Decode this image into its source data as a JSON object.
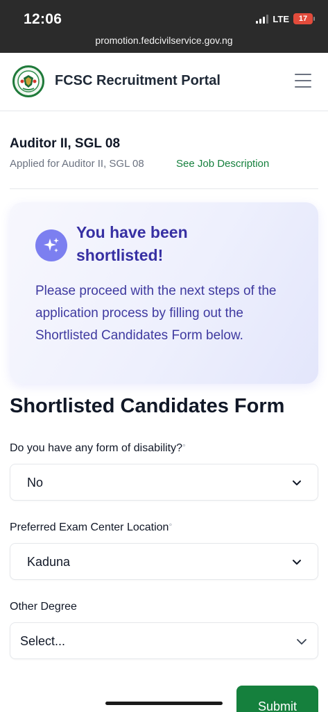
{
  "status_bar": {
    "time": "12:06",
    "network": "LTE",
    "battery": "17",
    "url": "promotion.fedcivilservice.gov.ng"
  },
  "header": {
    "title": "FCSC Recruitment Portal",
    "logo_icon": "coat-of-arms-icon",
    "menu_icon": "hamburger-menu-icon"
  },
  "job": {
    "title": "Auditor II, SGL 08",
    "applied_text": "Applied for Auditor II, SGL 08",
    "description_link": "See Job Description"
  },
  "banner": {
    "icon": "sparkles-icon",
    "title": "You have been shortlisted!",
    "message": "Please proceed with the next steps of the application process by filling out the Shortlisted Candidates Form below."
  },
  "form": {
    "title": "Shortlisted Candidates Form",
    "fields": [
      {
        "label": "Do you have any form of disability?",
        "required_mark": "°",
        "value": "No"
      },
      {
        "label": "Preferred Exam Center Location",
        "required_mark": "°",
        "value": "Kaduna"
      },
      {
        "label": "Other Degree",
        "required_mark": "",
        "value": "Select..."
      }
    ],
    "submit_label": "Submit"
  },
  "colors": {
    "accent_green": "#15803d",
    "banner_text": "#3730a3",
    "icon_purple": "#7c7ff0"
  }
}
